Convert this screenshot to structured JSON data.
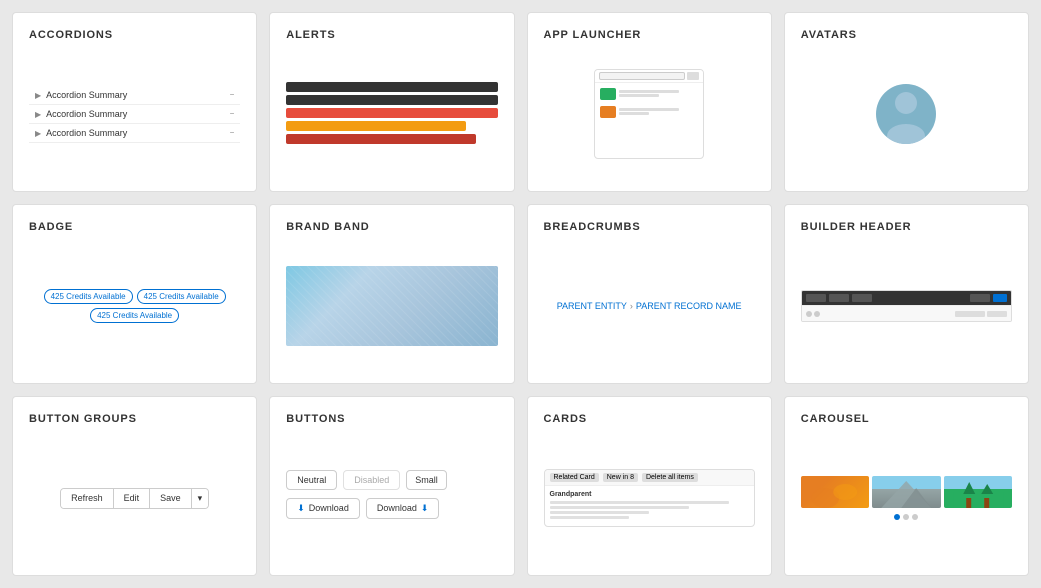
{
  "cards": [
    {
      "id": "accordions",
      "title": "ACCORDIONS",
      "type": "accordions"
    },
    {
      "id": "alerts",
      "title": "ALERTS",
      "type": "alerts"
    },
    {
      "id": "app-launcher",
      "title": "APP LAUNCHER",
      "type": "app-launcher"
    },
    {
      "id": "avatars",
      "title": "AVATARS",
      "type": "avatars"
    },
    {
      "id": "badge",
      "title": "BADGE",
      "type": "badge"
    },
    {
      "id": "brand-band",
      "title": "BRAND BAND",
      "type": "brand-band"
    },
    {
      "id": "breadcrumbs",
      "title": "BREADCRUMBS",
      "type": "breadcrumbs"
    },
    {
      "id": "builder-header",
      "title": "BUILDER HEADER",
      "type": "builder-header"
    },
    {
      "id": "button-groups",
      "title": "BUTTON GROUPS",
      "type": "button-groups"
    },
    {
      "id": "buttons",
      "title": "BUTTONS",
      "type": "buttons"
    },
    {
      "id": "cards",
      "title": "CARDS",
      "type": "cards"
    },
    {
      "id": "carousel",
      "title": "CAROUSEL",
      "type": "carousel"
    }
  ],
  "accordions": {
    "rows": [
      "Accordion Summary",
      "Accordion Summary",
      "Accordion Summary"
    ]
  },
  "badge": {
    "items": [
      "425 Credits Available",
      "425 Credits Available",
      "425 Credits Available"
    ]
  },
  "breadcrumbs": {
    "parent": "PARENT ENTITY",
    "separator": "›",
    "child": "PARENT RECORD NAME"
  },
  "buttons": {
    "row1": [
      "Neutral",
      "Disabled",
      "Small"
    ],
    "row2_left": "Download",
    "row2_right": "Download",
    "download_icon": "⬇"
  },
  "button_groups": {
    "items": [
      "Refresh",
      "Edit",
      "Save"
    ],
    "arrow": "▾"
  }
}
